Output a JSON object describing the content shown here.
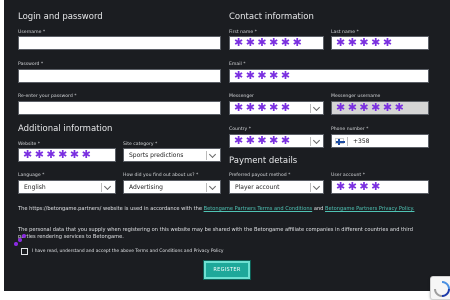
{
  "sections": {
    "login": "Login and password",
    "contact": "Contact information",
    "additional": "Additional information",
    "payment": "Payment details"
  },
  "labels": {
    "username": "Username *",
    "password": "Password *",
    "reenter_password": "Re-enter your password *",
    "first_name": "First name *",
    "last_name": "Last name *",
    "email": "Email *",
    "messenger": "Messenger",
    "messenger_username": "Messenger username",
    "website": "Website *",
    "site_category": "Site category *",
    "country": "Country *",
    "phone": "Phone number *",
    "language": "Language *",
    "heard_about": "How did you find out about us? *",
    "payout_method": "Preferred payout method *",
    "user_account": "User account *"
  },
  "values": {
    "username": "",
    "password": "",
    "reenter_password": "",
    "first_name": "✱✱✱✱✱✱",
    "last_name": "✱✱✱✱✱",
    "email": "✱✱✱✱✱",
    "messenger": "✱✱✱✱✱",
    "messenger_username": "✱✱✱✱✱✱",
    "website": "✱✱✱✱✱✱",
    "site_category": "Sports predictions",
    "country": "✱✱✱✱✱",
    "phone": "+358",
    "language": "English",
    "heard_about": "Advertising",
    "payout_method": "Player account",
    "user_account": "✱✱✱✱"
  },
  "terms": {
    "line1_prefix": "The https://betongame.partners/ website is used in accordance with the ",
    "link1": "Betongame Partners Terms and Conditions",
    "and": " and ",
    "link2": "Betongame Partners Privacy Policy.",
    "line2": "The personal data that you supply when registering on this website may be shared with the Betongame affiliate companies in different countries and third parties rendering services to Betongame.",
    "agree": "I have read, understand and accept the above Terms and Conditions and Privacy Policy"
  },
  "buttons": {
    "register": "REGISTER"
  },
  "colors": {
    "panel_bg": "#1b1d21",
    "accent_teal": "#1ea89a",
    "star_purple": "#7a2fe0",
    "link": "#4fc3b4"
  },
  "icons": {
    "flag": "finland-flag-icon",
    "caret": "chevron-down-icon",
    "recaptcha": "recaptcha-icon"
  }
}
